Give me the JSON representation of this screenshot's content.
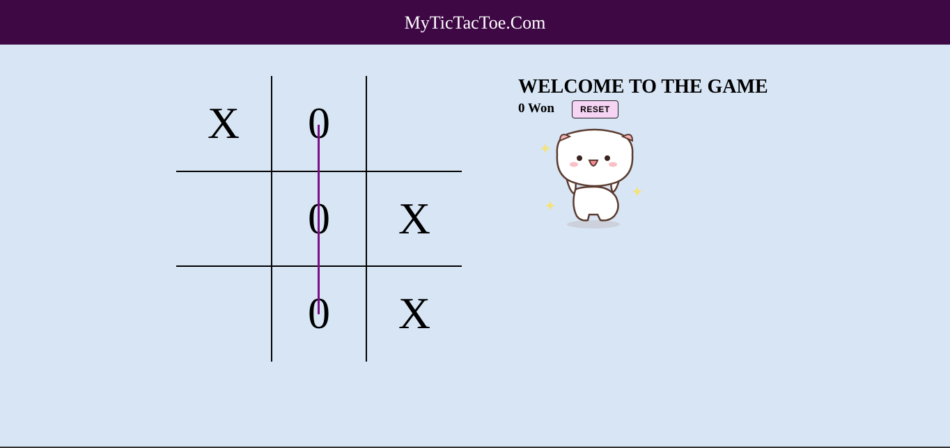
{
  "header": {
    "title": "MyTicTacToe.Com"
  },
  "board": {
    "cells": [
      "X",
      "0",
      "",
      "",
      "0",
      "X",
      "",
      "0",
      "X"
    ],
    "winning_line": "middle-column",
    "win_line_color": "#7a0f86"
  },
  "info": {
    "heading": "WELCOME TO THE GAME",
    "status": "0 Won",
    "reset_label": "RESET"
  },
  "colors": {
    "navbar": "#3e0845",
    "background": "#d8e5f5",
    "reset_button": "#f6d4f4"
  },
  "illustration": {
    "icon": "celebrating-cat-icon"
  }
}
